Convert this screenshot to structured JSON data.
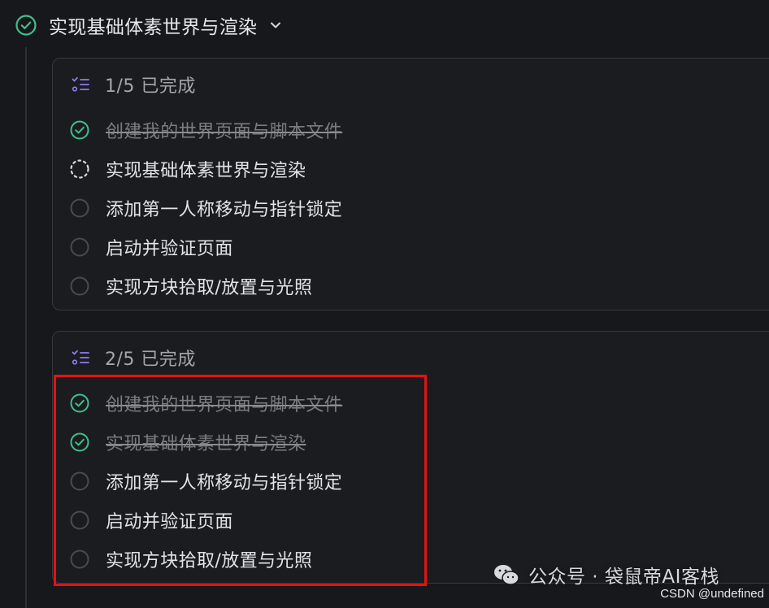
{
  "task": {
    "title": "实现基础体素世界与渲染",
    "status_icon": "check-circle-icon",
    "toggle_icon": "chevron-down-icon"
  },
  "cards": [
    {
      "progress": "1/5 已完成",
      "items": [
        {
          "label": "创建我的世界页面与脚本文件",
          "state": "done"
        },
        {
          "label": "实现基础体素世界与渲染",
          "state": "in-progress"
        },
        {
          "label": "添加第一人称移动与指针锁定",
          "state": "pending"
        },
        {
          "label": "启动并验证页面",
          "state": "pending"
        },
        {
          "label": "实现方块拾取/放置与光照",
          "state": "pending"
        }
      ]
    },
    {
      "progress": "2/5 已完成",
      "items": [
        {
          "label": "创建我的世界页面与脚本文件",
          "state": "done"
        },
        {
          "label": "实现基础体素世界与渲染",
          "state": "done"
        },
        {
          "label": "添加第一人称移动与指针锁定",
          "state": "pending"
        },
        {
          "label": "启动并验证页面",
          "state": "pending"
        },
        {
          "label": "实现方块拾取/放置与光照",
          "state": "pending"
        }
      ]
    }
  ],
  "watermark": {
    "text": "公众号 · 袋鼠帝AI客栈",
    "icon": "wechat-icon"
  },
  "source_credit": "CSDN @undefined",
  "colors": {
    "done_green": "#3fbf8a",
    "list_icon_purple": "#8b7ff0",
    "highlight_red": "#e01414"
  }
}
